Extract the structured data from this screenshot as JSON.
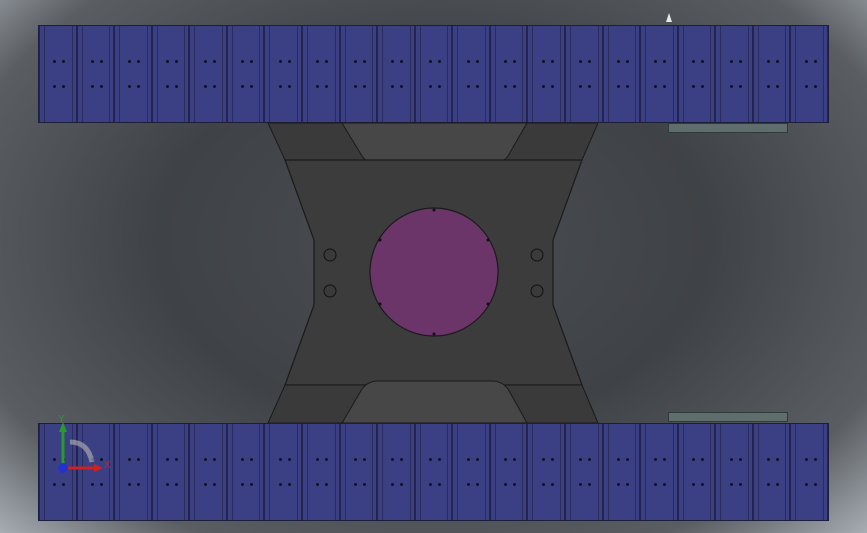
{
  "viewport": {
    "description": "",
    "background_color": "#45484c",
    "track_color": "#3b3f84",
    "chassis_color": "#3d3d3d",
    "disc_color": "#6b3569",
    "rail_color": "#5f6d6c"
  },
  "track_top": {
    "links": 21
  },
  "track_bottom": {
    "links": 21
  },
  "triad": {
    "x_label": "X",
    "y_label": "Y"
  },
  "icons": [
    "axis-triad-icon",
    "cursor-icon"
  ]
}
